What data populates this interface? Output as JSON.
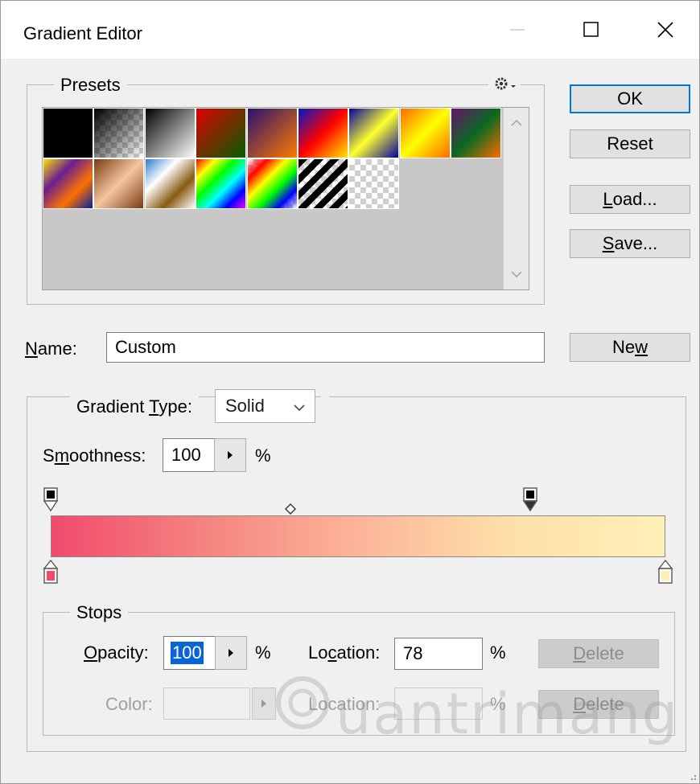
{
  "window": {
    "title": "Gradient Editor",
    "controls": {
      "minimize_icon": "minimize-icon",
      "maximize_icon": "maximize-icon",
      "close_icon": "close-icon"
    }
  },
  "presets": {
    "legend": "Presets",
    "menu_icon": "gear-icon",
    "swatches": [
      {
        "name": "foreground-to-background",
        "colors": [
          "#000000",
          "#000000"
        ]
      },
      {
        "name": "foreground-to-transparent",
        "colors": [
          "#000000",
          "transparent"
        ]
      },
      {
        "name": "black-white",
        "colors": [
          "#000000",
          "#ffffff"
        ]
      },
      {
        "name": "red-green",
        "colors": [
          "#e00000",
          "#006000"
        ]
      },
      {
        "name": "violet-orange",
        "colors": [
          "#2a1070",
          "#ff7a00"
        ]
      },
      {
        "name": "blue-red-yellow",
        "colors": [
          "#0018c8",
          "#ff0000",
          "#ffe800"
        ]
      },
      {
        "name": "blue-yellow-blue",
        "colors": [
          "#0000a0",
          "#ffff30",
          "#0000a0"
        ]
      },
      {
        "name": "orange-yellow-orange",
        "colors": [
          "#ff6a00",
          "#ffff00",
          "#ff6a00"
        ]
      },
      {
        "name": "violet-green-orange",
        "colors": [
          "#6a1070",
          "#0a6a20",
          "#ff6a00"
        ]
      },
      {
        "name": "yellow-violet-orange-blue",
        "colors": [
          "#ffe000",
          "#6a2090",
          "#ff7000",
          "#0020a0"
        ]
      },
      {
        "name": "copper",
        "colors": [
          "#7a3a10",
          "#f6c6a0",
          "#7a3a10"
        ]
      },
      {
        "name": "chrome",
        "colors": [
          "#2a7ad0",
          "#ffffff",
          "#8a5a10",
          "#ffffff"
        ]
      },
      {
        "name": "spectrum",
        "colors": [
          "#ff0000",
          "#ffff00",
          "#00ff00",
          "#00ffff",
          "#0000ff",
          "#ff00ff"
        ]
      },
      {
        "name": "transparent-rainbow",
        "colors": [
          "transparent",
          "#ff0000",
          "#ffff00",
          "#00ff00",
          "#0000ff",
          "transparent"
        ]
      },
      {
        "name": "transparent-stripes",
        "colors": [
          "#000000",
          "transparent"
        ]
      },
      {
        "name": "transparent",
        "colors": [
          "transparent",
          "transparent"
        ]
      }
    ]
  },
  "buttons": {
    "ok": "OK",
    "reset": "Reset",
    "load_pre": "",
    "load_u": "L",
    "load_post": "oad...",
    "save_u": "S",
    "save_post": "ave...",
    "new_pre": "Ne",
    "new_u": "w"
  },
  "name_field": {
    "label_u": "N",
    "label_post": "ame:",
    "value": "Custom"
  },
  "gradient": {
    "type_label_pre": "Gradient ",
    "type_label_u": "T",
    "type_label_post": "ype:",
    "type_value": "Solid",
    "smoothness_label_pre": "S",
    "smoothness_label_u": "m",
    "smoothness_label_post": "oothness:",
    "smoothness_value": "100",
    "smoothness_unit": "%",
    "colors": [
      "#f14a6d",
      "#f4847f",
      "#fcb59a",
      "#fde0a8",
      "#fff0b8"
    ],
    "opacity_stops": [
      {
        "location": 0
      },
      {
        "location": 78
      }
    ],
    "midpoint_location": 39,
    "color_stops": [
      {
        "location": 0,
        "color": "#f14a6d"
      },
      {
        "location": 100,
        "color": "#fff0b8"
      }
    ]
  },
  "stops": {
    "legend": "Stops",
    "opacity_label_u": "O",
    "opacity_label_post": "pacity:",
    "opacity_value": "100",
    "opacity_unit": "%",
    "location_label_pre": "Lo",
    "location_label_u": "c",
    "location_label_post": "ation:",
    "location_value": "78",
    "location_unit": "%",
    "delete_u": "D",
    "delete_post": "elete",
    "color_label": "Color:",
    "color_location_label": "Location:",
    "color_location_unit": "%"
  }
}
